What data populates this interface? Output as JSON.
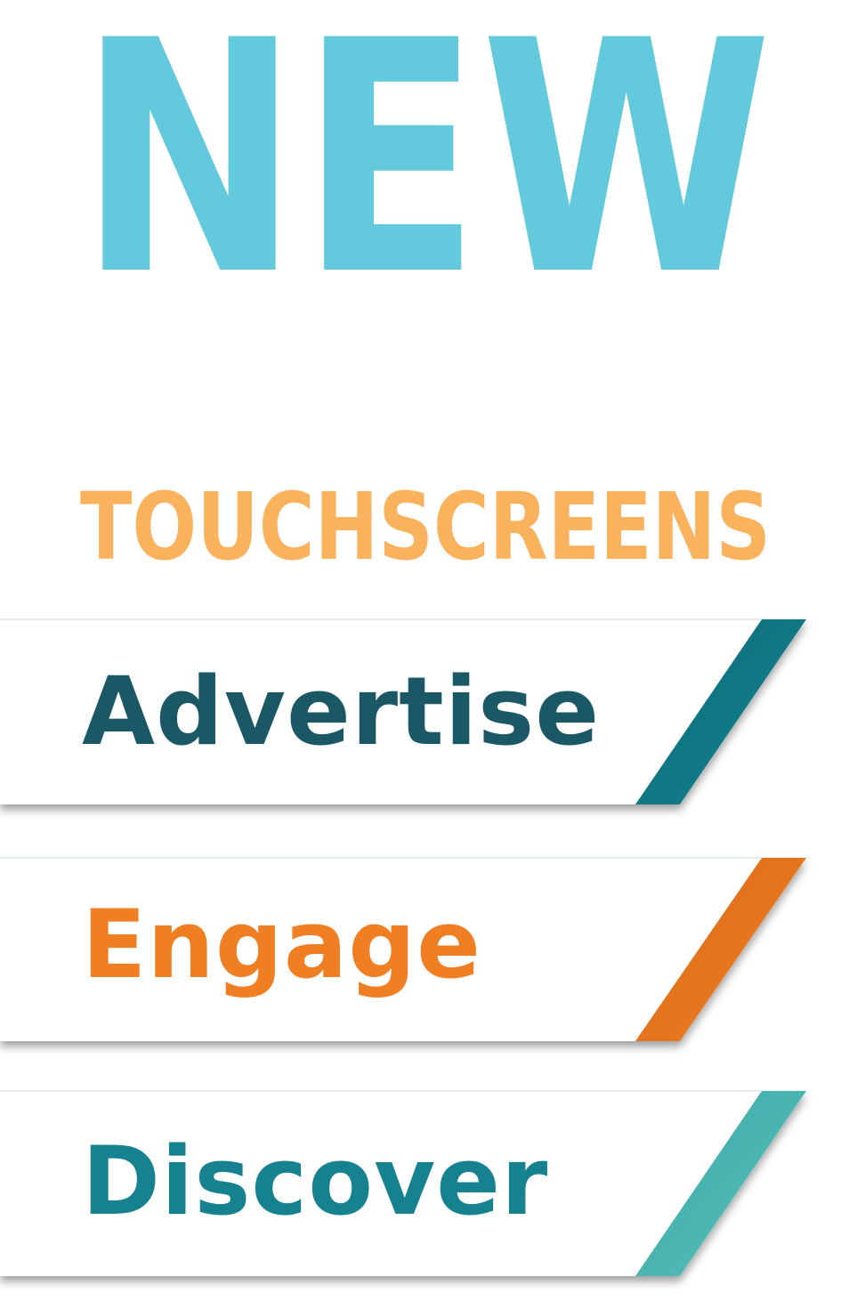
{
  "headline": {
    "text": "NEW",
    "color": "#63c9dd"
  },
  "subhead": {
    "text": "TOUCHSCREENS",
    "color": "#fbb25c"
  },
  "banners": [
    {
      "label": "Advertise",
      "text_color": "#1b5866",
      "stripe_color": "#13838f",
      "stripe_dark": "#0e6b78"
    },
    {
      "label": "Engage",
      "text_color": "#f07f24",
      "stripe_color": "#f07f24",
      "stripe_dark": "#d96a16"
    },
    {
      "label": "Discover",
      "text_color": "#16818f",
      "stripe_color": "#5bc1bd",
      "stripe_dark": "#3aa8a6"
    }
  ]
}
